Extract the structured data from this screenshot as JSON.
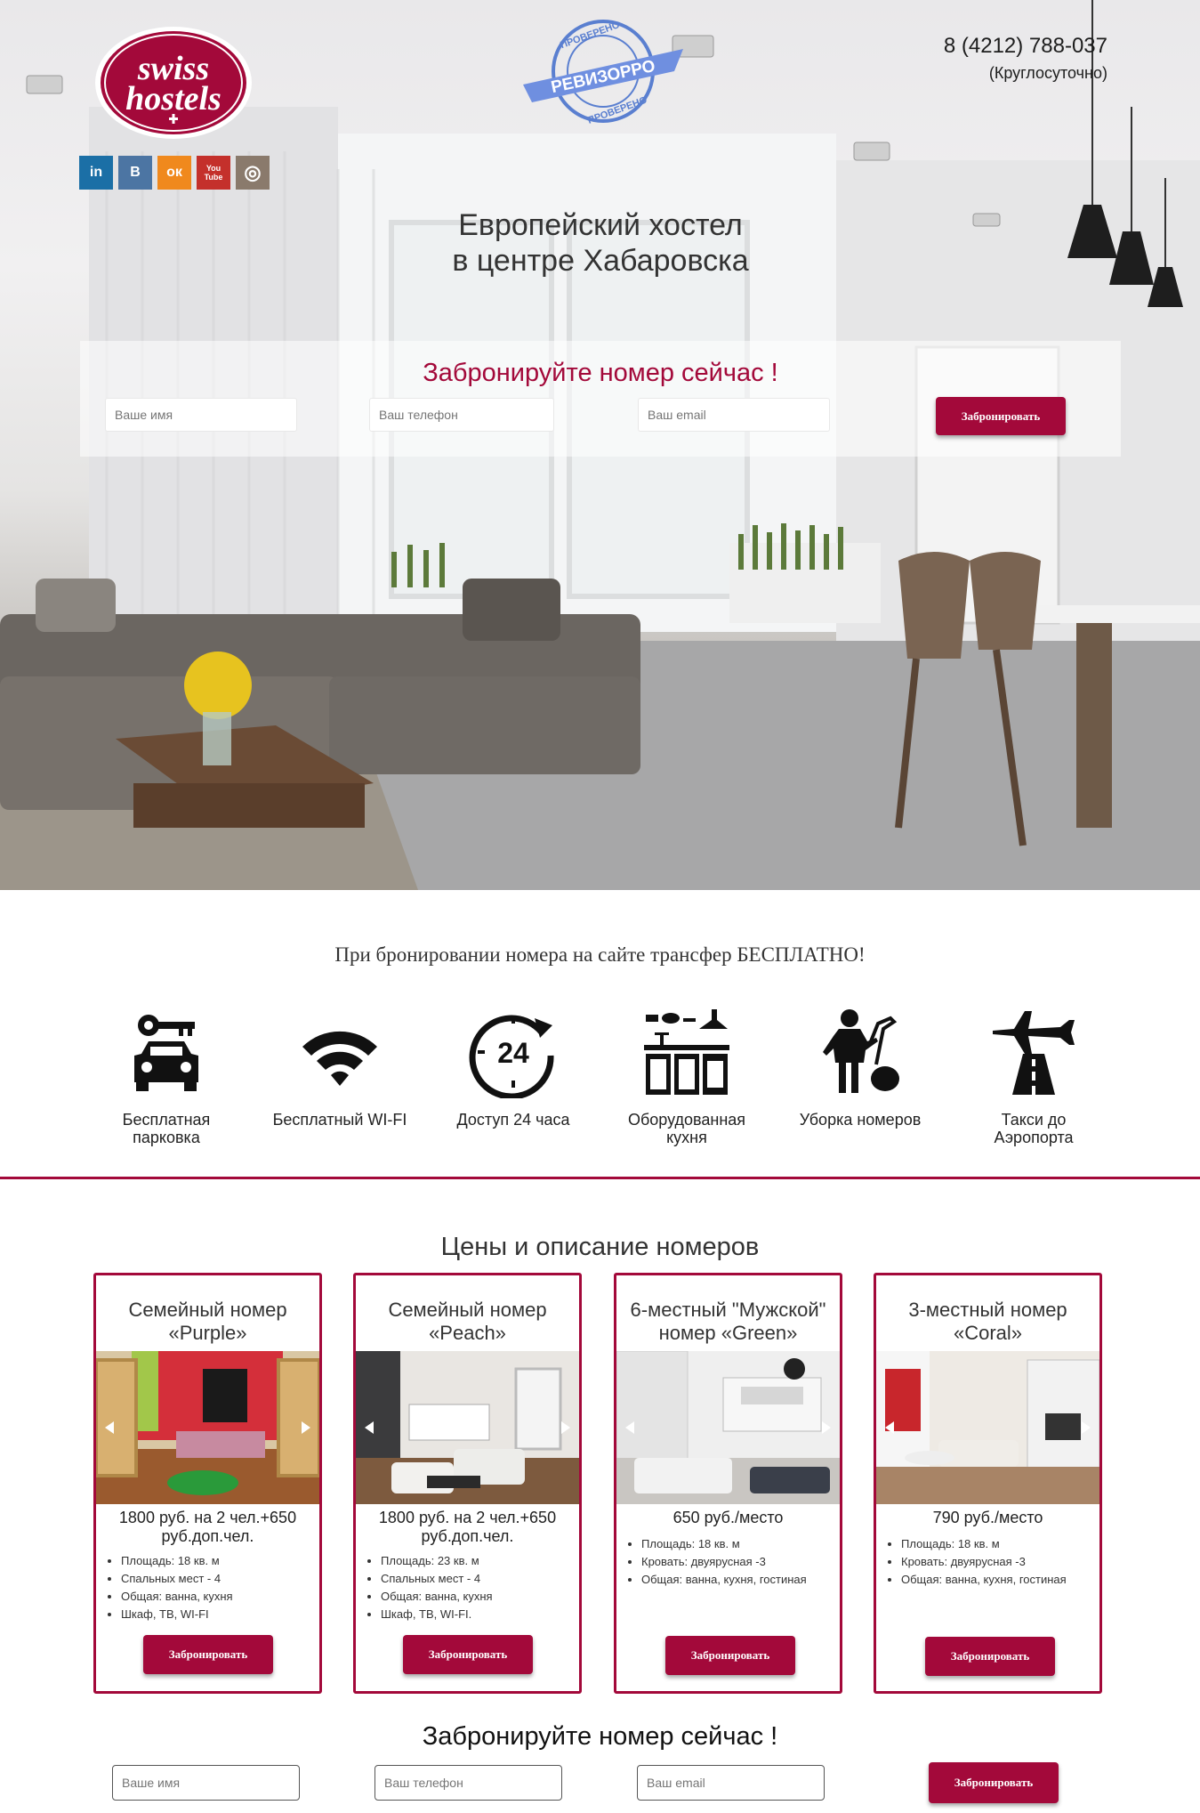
{
  "header": {
    "logo_line1": "swiss",
    "logo_line2": "hostels",
    "stamp_top": "ПРОВЕРЕНО",
    "stamp_center": "РЕВИЗОРРО",
    "stamp_bottom": "ПРОВЕРЕНО",
    "phone": "8 (4212) 788-037",
    "hours": "(Круглосуточно)",
    "social": [
      {
        "label": "in",
        "icon": "linkedin-icon",
        "color": "#1b6fa6"
      },
      {
        "label": "B",
        "icon": "vk-icon",
        "color": "#4c75a3"
      },
      {
        "label": "ок",
        "icon": "odnoklassniki-icon",
        "color": "#f0891d"
      },
      {
        "label": "You Tube",
        "icon": "youtube-icon",
        "color": "#c4302b"
      },
      {
        "label": "◎",
        "icon": "instagram-icon",
        "color": "#8a7a6c"
      }
    ]
  },
  "hero": {
    "title_line1": "Европейский хостел",
    "title_line2": "в центре Хабаровска"
  },
  "booking_top": {
    "title": "Забронируйте номер сейчас !",
    "name_placeholder": "Ваше имя",
    "phone_placeholder": "Ваш телефон",
    "email_placeholder": "Ваш email",
    "button": "Забронировать"
  },
  "features": {
    "transfer": "При бронировании номера на сайте трансфер БЕСПЛАТНО!",
    "items": [
      {
        "line1": "Бесплатная",
        "line2": "парковка",
        "icon": "car-key-icon"
      },
      {
        "line1": "Бесплатный WI-FI",
        "line2": "",
        "icon": "wifi-icon"
      },
      {
        "line1": "Доступ 24 часа",
        "line2": "",
        "icon": "clock-24-icon"
      },
      {
        "line1": "Оборудованная",
        "line2": "кухня",
        "icon": "kitchen-icon"
      },
      {
        "line1": "Уборка номеров",
        "line2": "",
        "icon": "cleaning-icon"
      },
      {
        "line1": "Такси до",
        "line2": "Аэропорта",
        "icon": "airplane-road-icon"
      }
    ]
  },
  "rooms": {
    "title": "Цены и описание номеров",
    "accent": "#a3093a",
    "cards": [
      {
        "name1": "Семейный номер",
        "name2": "«Purple»",
        "price1": "1800 руб. на 2 чел.+650",
        "price2": "руб.доп.чел.",
        "features": [
          "Площадь: 18 кв. м",
          "Спальных мест - 4",
          "Общая: ванна, кухня",
          "Шкаф, ТВ, WI-FI"
        ],
        "button": "Забронировать"
      },
      {
        "name1": "Семейный номер",
        "name2": "«Peach»",
        "price1": "1800 руб. на 2 чел.+650",
        "price2": "руб.доп.чел.",
        "features": [
          "Площадь: 23 кв. м",
          "Спальных мест - 4",
          "Общая: ванна, кухня",
          "Шкаф, ТВ, WI-FI."
        ],
        "button": "Забронировать"
      },
      {
        "name1": "6-местный \"Мужской\"",
        "name2": "номер «Green»",
        "price1": "650 руб./место",
        "price2": "",
        "features": [
          "Площадь: 18 кв. м",
          "Кровать: двуярусная -3",
          "Общая: ванна, кухня, гостиная"
        ],
        "button": "Забронировать"
      },
      {
        "name1": "3-местный номер",
        "name2": "«Coral»",
        "price1": "790 руб./место",
        "price2": "",
        "features": [
          "Площадь: 18 кв. м",
          "Кровать: двуярусная -3",
          "Общая: ванна, кухня, гостиная"
        ],
        "button": "Забронировать"
      }
    ]
  },
  "booking_bottom": {
    "title": "Забронируйте номер сейчас !",
    "name_placeholder": "Ваше имя",
    "phone_placeholder": "Ваш телефон",
    "email_placeholder": "Ваш email",
    "button": "Забронировать"
  }
}
